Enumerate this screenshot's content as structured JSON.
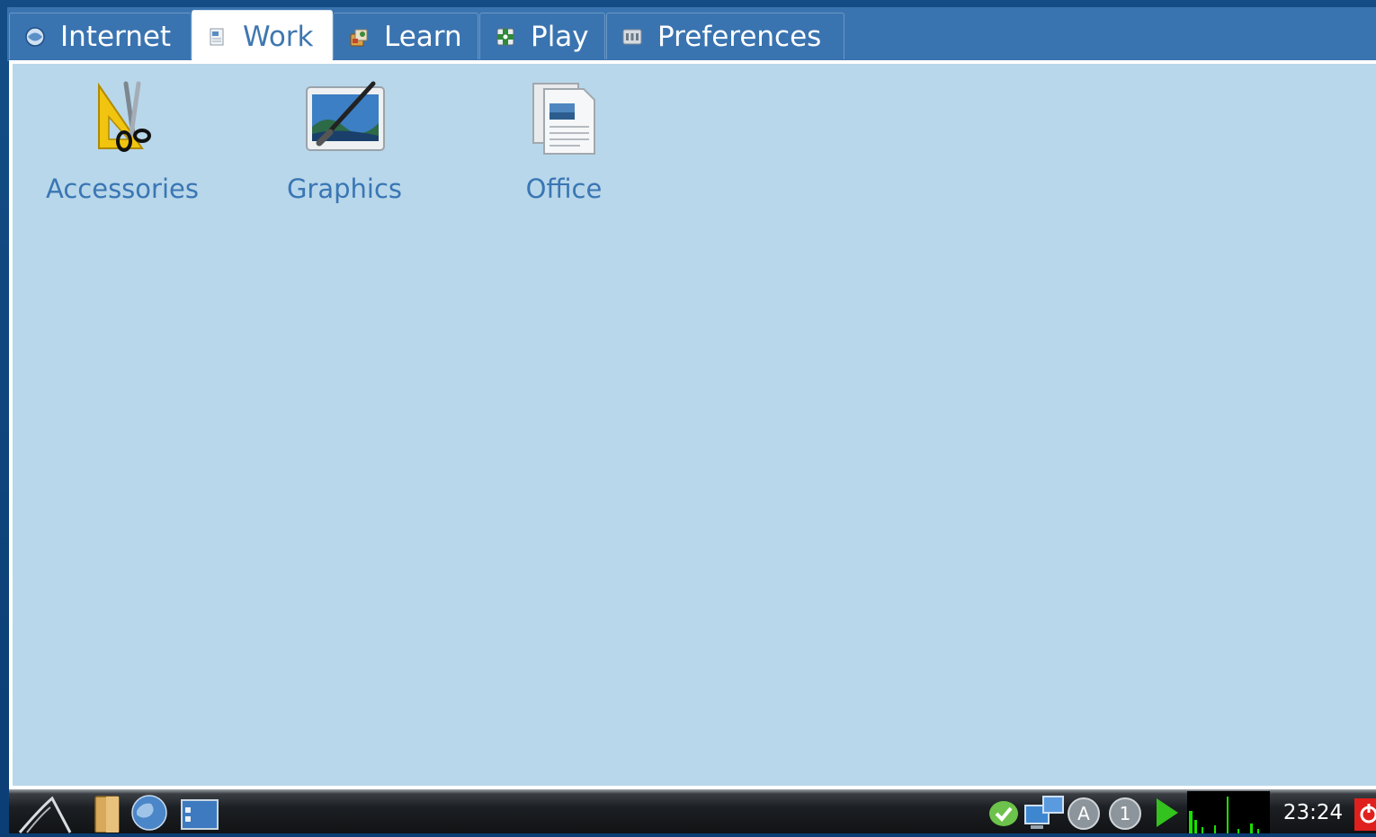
{
  "tabs": [
    {
      "label": "Internet",
      "icon": "internet-icon",
      "active": false
    },
    {
      "label": "Work",
      "icon": "work-icon",
      "active": true
    },
    {
      "label": "Learn",
      "icon": "learn-icon",
      "active": false
    },
    {
      "label": "Play",
      "icon": "play-icon",
      "active": false
    },
    {
      "label": "Preferences",
      "icon": "preferences-icon",
      "active": false
    }
  ],
  "launchers": [
    {
      "label": "Accessories",
      "icon": "accessories-icon"
    },
    {
      "label": "Graphics",
      "icon": "graphics-icon"
    },
    {
      "label": "Office",
      "icon": "office-icon"
    }
  ],
  "taskbar": {
    "clock": "23:24",
    "items": [
      {
        "name": "start-menu-icon",
        "desc": "main menu"
      },
      {
        "name": "file-manager-icon",
        "desc": "files"
      },
      {
        "name": "web-browser-icon",
        "desc": "browser"
      },
      {
        "name": "show-desktop-icon",
        "desc": "desktop"
      }
    ],
    "tray": [
      "chat-status-icon",
      "network-icon",
      "updates-icon",
      "notifications-icon",
      "media-play-icon",
      "cpu-monitor-graph",
      "power-icon"
    ]
  },
  "colors": {
    "tab_bar": "#3a74b0",
    "active_tab_text": "#3f77b0",
    "panel_bg": "#b8d7ea",
    "launcher_text": "#3a76b4",
    "cpu_graph_line": "#19e000",
    "power": "#e0201c"
  }
}
